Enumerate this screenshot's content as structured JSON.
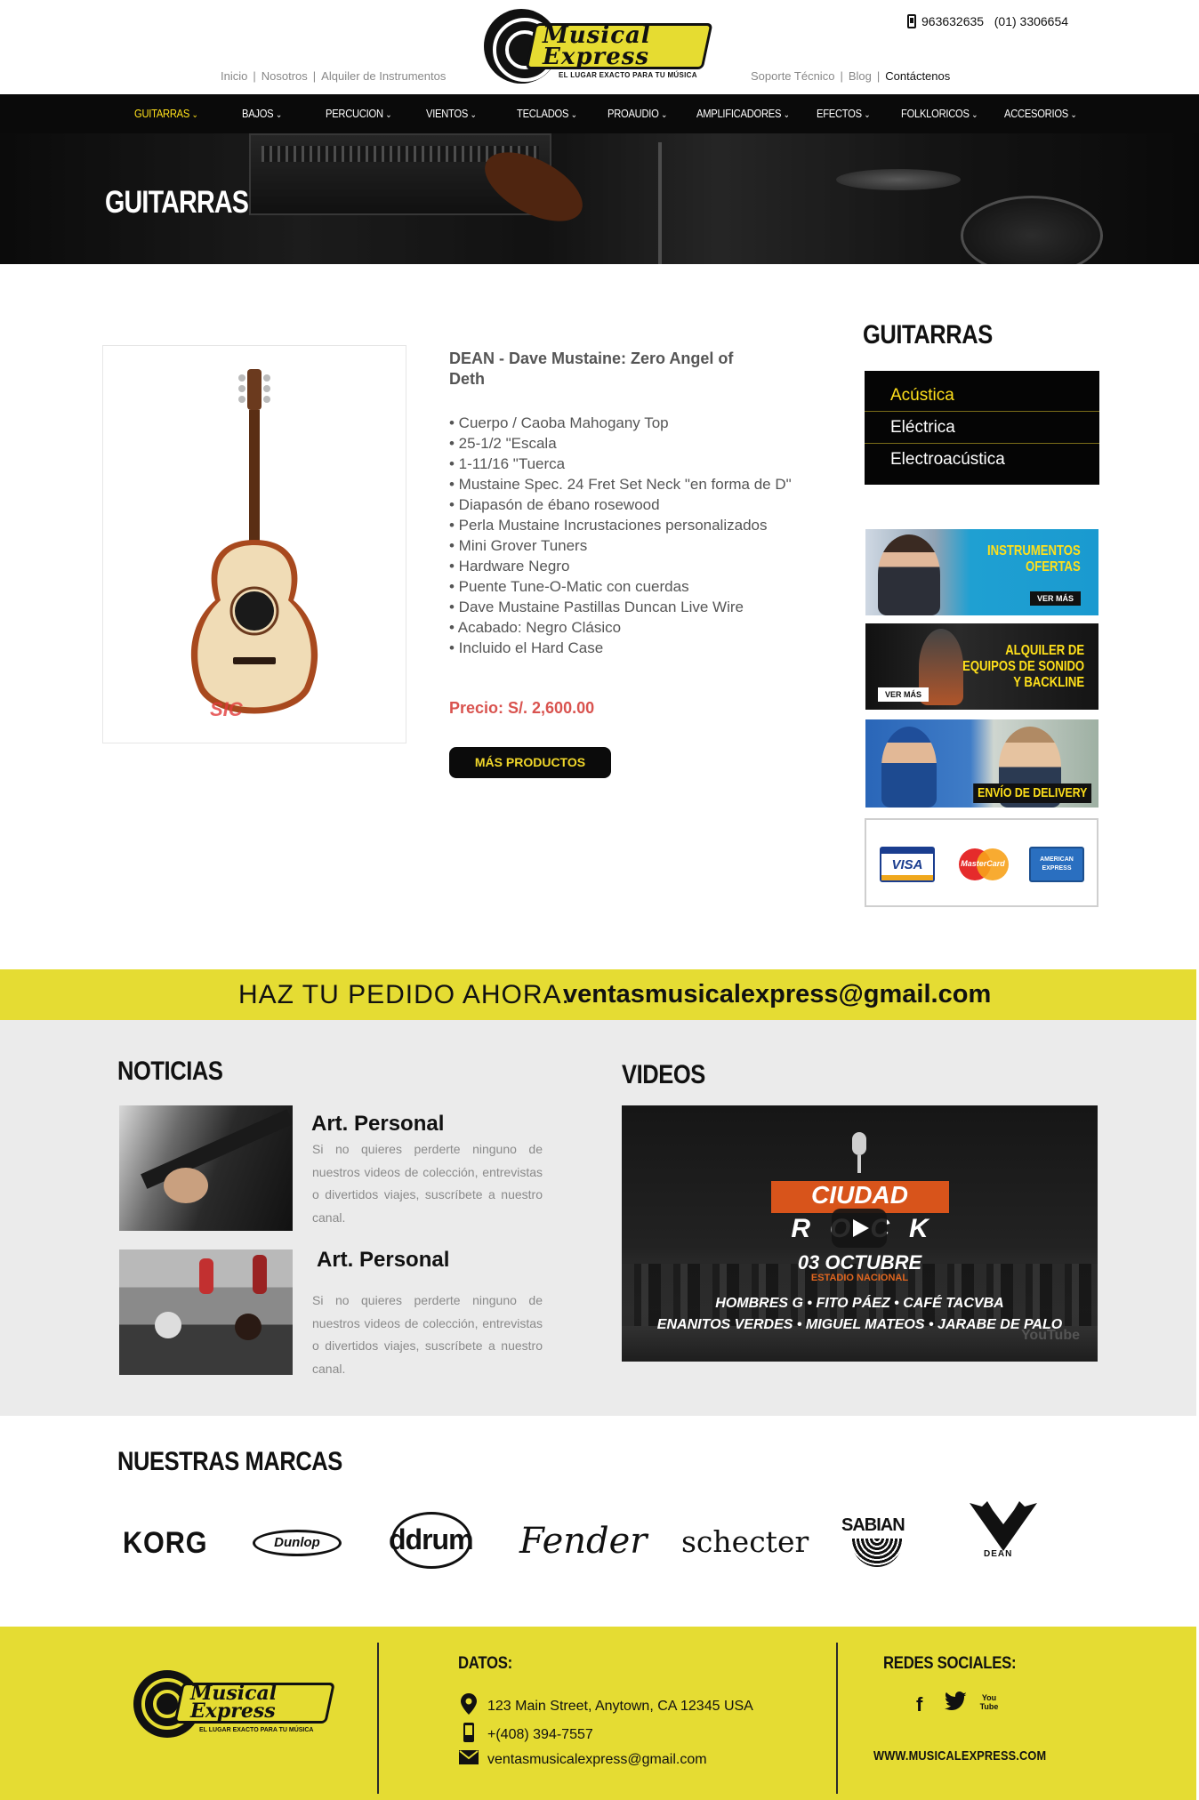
{
  "header": {
    "left_links": [
      "Inicio",
      "Nosotros",
      "Alquiler de Instrumentos"
    ],
    "right_links": [
      "Soporte Técnico",
      "Blog",
      "Contáctenos"
    ],
    "phones": "963632635   (01) 3306654",
    "logo": {
      "line1": "Musical",
      "line2": "Express",
      "tagline": "EL LUGAR EXACTO PARA TU MÚSICA"
    }
  },
  "nav": {
    "items": [
      "GUITARRAS",
      "BAJOS",
      "PERCUCION",
      "VIENTOS",
      "TECLADOS",
      "PROAUDIO",
      "AMPLIFICADORES",
      "EFECTOS",
      "FOLKLORICOS",
      "ACCESORIOS"
    ],
    "active_index": 0,
    "chevron": "⌄"
  },
  "hero": {
    "title": "GUITARRAS"
  },
  "product": {
    "title": "DEAN - Dave Mustaine: Zero Angel of Deth",
    "specs": [
      "• Cuerpo / Caoba Mahogany Top",
      "• 25-1/2 \"Escala",
      "• 1-11/16 \"Tuerca",
      "• Mustaine Spec. 24 Fret Set Neck \"en forma de D\"",
      "• Diapasón de ébano rosewood",
      "• Perla Mustaine Incrustaciones personalizados",
      "• Mini Grover Tuners",
      "• Hardware Negro",
      "• Puente Tune-O-Matic con cuerdas",
      "• Dave Mustaine Pastillas Duncan Live Wire",
      "• Acabado: Negro Clásico",
      "• Incluido el Hard Case"
    ],
    "price": "Precio: S/. 2,600.00",
    "more_button": "MÁS PRODUCTOS",
    "image_watermark": "SIC"
  },
  "sidebar": {
    "title": "GUITARRAS",
    "categories": [
      "Acústica",
      "Eléctrica",
      "Electroacústica"
    ],
    "active_index": 0,
    "promos": [
      {
        "text": "INSTRUMENTOS\nOFERTAS",
        "button": "VER MÁS"
      },
      {
        "text": "ALQUILER DE\nEQUIPOS DE SONIDO\nY BACKLINE",
        "button": "VER MÁS"
      },
      {
        "text": "ENVÍO DE DELIVERY",
        "button": ""
      }
    ],
    "payment_cards": [
      "VISA",
      "MasterCard",
      "AMERICAN EXPRESS"
    ]
  },
  "order": {
    "label": "HAZ TU PEDIDO AHORA:",
    "email": "ventasmusicalexpress@gmail.com"
  },
  "news": {
    "title": "NOTICIAS",
    "items": [
      {
        "title": "Art. Personal",
        "text": "Si no quieres perderte ninguno de nuestros videos de colección, entrevistas o divertidos viajes, suscríbete a nuestro canal."
      },
      {
        "title": "Art. Personal",
        "text": "Si no quieres perderte ninguno de nuestros videos de colección, entrevistas o divertidos viajes, suscríbete a nuestro canal."
      }
    ]
  },
  "videos": {
    "title": "VIDEOS",
    "video": {
      "word1": "CIUDAD",
      "word2": "ROCK",
      "date": "03 OCTUBRE",
      "venue": "ESTADIO NACIONAL",
      "line1": "HOMBRES G • FITO PÁEZ • CAFÉ TACVBA",
      "line2": "ENANITOS VERDES • MIGUEL MATEOS • JARABE DE PALO",
      "watermark": "YouTube"
    }
  },
  "brands": {
    "title": "NUESTRAS MARCAS",
    "items": [
      "KORG",
      "Dunlop",
      "ddrum",
      "Fender",
      "schecter",
      "SABIAN",
      "DEAN"
    ]
  },
  "footer": {
    "datos_title": "DATOS:",
    "address": "123 Main Street, Anytown, CA 12345 USA",
    "phone": "+(408) 394-7557",
    "email": "ventasmusicalexpress@gmail.com",
    "social_title": "REDES SOCIALES:",
    "social_icons": [
      "f",
      "twitter",
      "You Tube"
    ],
    "site": "WWW.MUSICALEXPRESS.COM"
  },
  "colors": {
    "brand_yellow": "#e5dc33",
    "nav_bg": "#0a0a0a",
    "active_yellow": "#ffe01b",
    "price_red": "#d9534f"
  }
}
